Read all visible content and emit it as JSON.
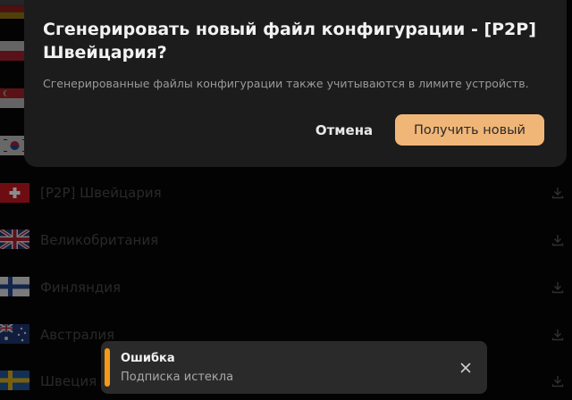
{
  "dialog": {
    "title": "Сгенерировать новый файл конфигурации - [P2P] Швейцария?",
    "description": "Сгенерированные файлы конфигурации также учитываются в лимите устройств.",
    "cancel_label": "Отмена",
    "confirm_label": "Получить новый"
  },
  "servers": [
    {
      "name": "",
      "flag": "germany-flag-icon"
    },
    {
      "name": "",
      "flag": "poland-flag-icon"
    },
    {
      "name": "",
      "flag": "singapore-flag-icon"
    },
    {
      "name": "",
      "flag": "south-korea-flag-icon"
    },
    {
      "name": "[P2P] Швейцария",
      "flag": "switzerland-flag-icon"
    },
    {
      "name": "Великобритания",
      "flag": "uk-flag-icon"
    },
    {
      "name": "Финляндия",
      "flag": "finland-flag-icon"
    },
    {
      "name": "Австралия",
      "flag": "australia-flag-icon"
    },
    {
      "name": "Швеция",
      "flag": "sweden-flag-icon"
    }
  ],
  "toast": {
    "title": "Ошибка",
    "message": "Подписка истекла"
  },
  "colors": {
    "accent_button": "#f0b678",
    "toast_accent": "#f39a1c",
    "dialog_bg": "#1c1c1c",
    "page_bg": "#050505"
  }
}
